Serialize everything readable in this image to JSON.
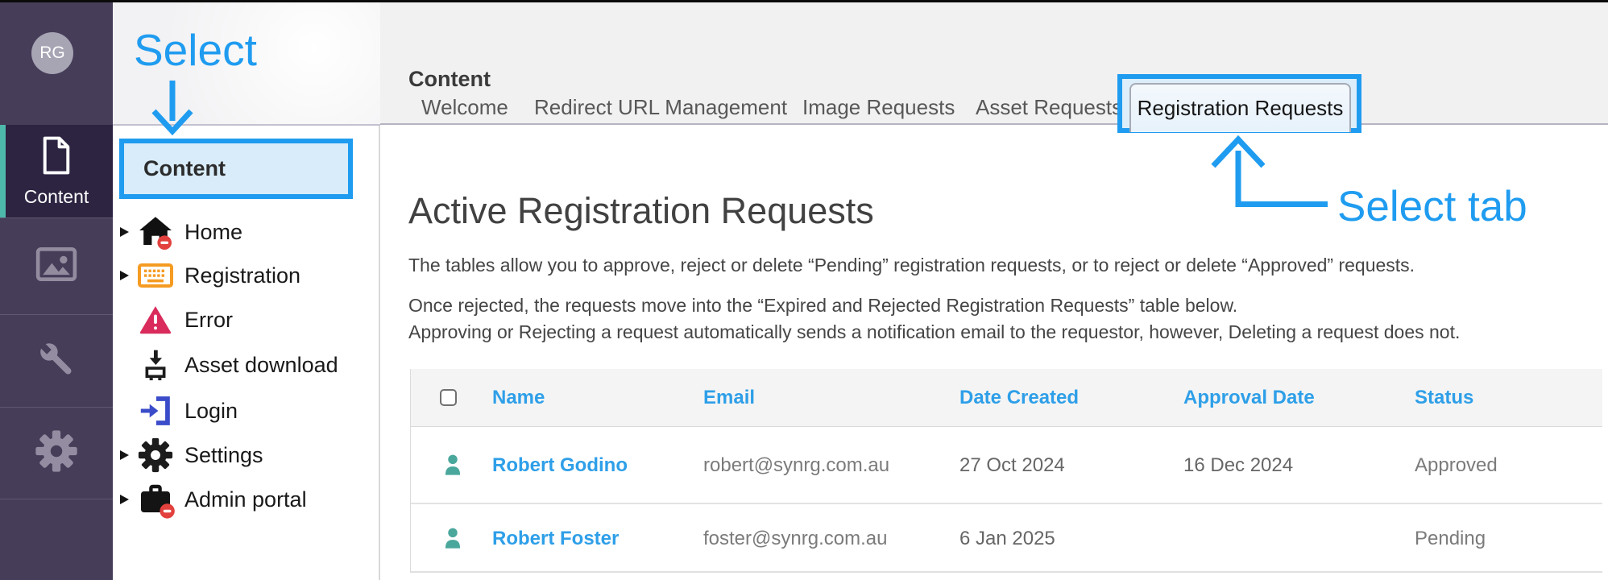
{
  "annotations": {
    "select_label": "Select",
    "select_tab_label": "Select tab",
    "accent_color": "#1f9cf0"
  },
  "app_rail": {
    "avatar_initials": "RG",
    "active_item_label": "Content",
    "icons": [
      "document-icon",
      "image-icon",
      "wrench-icon",
      "gear-icon"
    ]
  },
  "tree": {
    "header": "Content",
    "items": [
      {
        "label": "Home",
        "icon": "home-icon",
        "expandable": true
      },
      {
        "label": "Registration",
        "icon": "keyboard-icon",
        "expandable": true
      },
      {
        "label": "Error",
        "icon": "error-icon",
        "expandable": false
      },
      {
        "label": "Asset download",
        "icon": "asset-download-icon",
        "expandable": false
      },
      {
        "label": "Login",
        "icon": "login-icon",
        "expandable": false
      },
      {
        "label": "Settings",
        "icon": "settings-icon",
        "expandable": true
      },
      {
        "label": "Admin portal",
        "icon": "admin-portal-icon",
        "expandable": true
      }
    ]
  },
  "main": {
    "title": "Content",
    "tabs": [
      {
        "label": "Welcome",
        "active": false
      },
      {
        "label": "Redirect URL Management",
        "active": false
      },
      {
        "label": "Image Requests",
        "active": false
      },
      {
        "label": "Asset Requests",
        "active": false
      },
      {
        "label": "Registration Requests",
        "active": true
      }
    ],
    "heading": "Active Registration Requests",
    "intro": "The tables allow you to approve, reject or delete “Pending” registration requests, or to reject or delete “Approved” requests.",
    "note_line1": "Once rejected, the requests move into the “Expired and Rejected Registration Requests” table below.",
    "note_line2": "Approving or Rejecting a request automatically sends a notification email to the requestor, however, Deleting a request does not.",
    "table": {
      "columns": [
        "Name",
        "Email",
        "Date Created",
        "Approval Date",
        "Status"
      ],
      "rows": [
        {
          "name": "Robert Godino",
          "email": "robert@synrg.com.au",
          "date_created": "27 Oct 2024",
          "approval_date": "16 Dec 2024",
          "status": "Approved"
        },
        {
          "name": "Robert Foster",
          "email": "foster@synrg.com.au",
          "date_created": "6 Jan 2025",
          "approval_date": "",
          "status": "Pending"
        }
      ]
    }
  },
  "colors": {
    "rail_bg": "#463d59",
    "rail_active_bg": "#2d2442",
    "rail_active_teal": "#4db9ab",
    "annotation_blue": "#1f9cf0",
    "table_link_blue": "#2e9fe8",
    "person_icon_teal": "#4aa79c",
    "error_icon_red": "#d92c5c",
    "keyboard_icon_orange": "#f59b22",
    "login_icon_blue": "#3a4cc9",
    "badge_red": "#e2413e"
  }
}
